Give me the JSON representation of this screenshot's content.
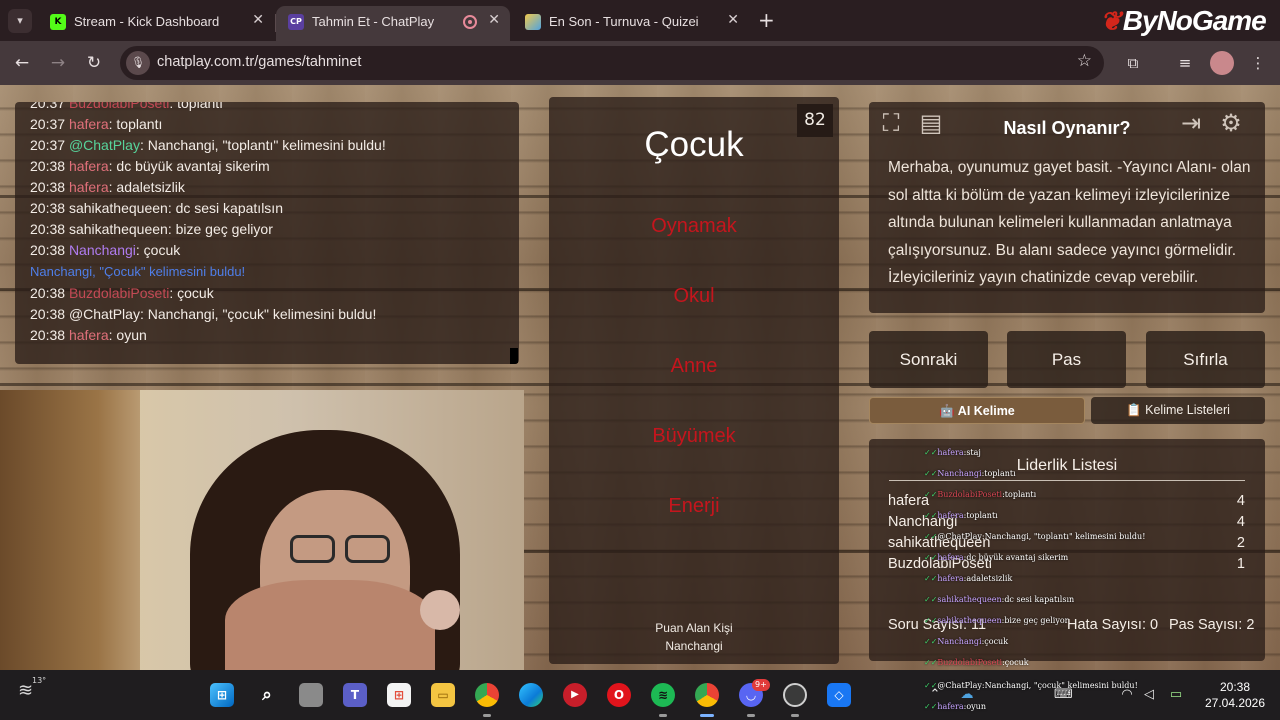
{
  "browser": {
    "tabs": [
      {
        "title": "Stream - Kick Dashboard",
        "favicon": "K",
        "active": false
      },
      {
        "title": "Tahmin Et - ChatPlay",
        "favicon": "CP",
        "active": true
      },
      {
        "title": "En Son - Turnuva - Quizei",
        "favicon": "Q",
        "active": false
      }
    ],
    "url": "chatplay.com.tr/games/tahminet",
    "brand": "ByNoGame"
  },
  "chat": {
    "lines": [
      {
        "time": "20:37",
        "user": "BuzdolabiPoseti",
        "text": ": toplantı"
      },
      {
        "time": "20:37",
        "user": "hafera",
        "text": ": toplantı"
      },
      {
        "time": "20:37",
        "user": "@ChatPlay",
        "text": ": Nanchangi, \"toplantı\" kelimesini buldu!"
      },
      {
        "time": "20:38",
        "user": "hafera",
        "text": ": dc büyük avantaj sikerim"
      },
      {
        "time": "20:38",
        "user": "hafera",
        "text": ": adaletsizlik"
      },
      {
        "time": "20:38",
        "user": "sahikathequeen",
        "text": ": dc sesi kapatılsın"
      },
      {
        "time": "20:38",
        "user": "sahikathequeen",
        "text": ": bize geç geliyor"
      },
      {
        "time": "20:38",
        "user": "Nanchangi",
        "text": ": çocuk"
      },
      {
        "time": "",
        "user": "Nanchangi, \"Çocuk\" kelimesini buldu!",
        "text": ""
      },
      {
        "time": "20:38",
        "user": "BuzdolabiPoseti",
        "text": ": çocuk"
      },
      {
        "time": "20:38",
        "user": "@ChatPlay",
        "text": ": Nanchangi, \"çocuk\" kelimesini buldu!"
      },
      {
        "time": "20:38",
        "user": "hafera",
        "text": ": oyun"
      }
    ]
  },
  "game": {
    "timer": "82",
    "word": "Çocuk",
    "taboo_words": [
      "Oynamak",
      "Okul",
      "Anne",
      "Büyümek",
      "Enerji"
    ],
    "scorer_label": "Puan Alan Kişi",
    "scorer_name": "Nanchangi"
  },
  "help": {
    "title": "Nasıl Oynanır?",
    "body": "Merhaba, oyunumuz gayet basit. -Yayıncı Alanı- olan sol altta ki bölüm de yazan kelimeyi izleyicilerinize altında bulunan kelimeleri kullanmadan anlatmaya çalışıyorsunuz. Bu alanı sadece yayıncı görmelidir. İzleyicileriniz yayın chatinizde cevap verebilir."
  },
  "controls": {
    "next": "Sonraki",
    "pass": "Pas",
    "reset": "Sıfırla",
    "ai_word": "🤖 AI Kelime",
    "word_lists": "📋 Kelime Listeleri"
  },
  "leaderboard": {
    "title": "Liderlik Listesi",
    "rows": [
      {
        "name": "hafera",
        "score": "4"
      },
      {
        "name": "Nanchangi",
        "score": "4"
      },
      {
        "name": "sahikathequeen",
        "score": "2"
      },
      {
        "name": "BuzdolabiPoseti",
        "score": "1"
      }
    ],
    "question_count": "Soru Sayısı: 11",
    "error_count": "Hata Sayısı: 0",
    "pass_count": "Pas Sayısı: 2"
  },
  "overlay_chat": [
    {
      "user": "hafera",
      "text": "staj"
    },
    {
      "user": "Nanchangi",
      "text": "toplantı"
    },
    {
      "user": "BuzdolabiPoseti",
      "text": "toplantı"
    },
    {
      "user": "hafera",
      "text": "toplantı"
    },
    {
      "user": "@ChatPlay",
      "text": "Nanchangi, \"toplantı\" kelimesini buldu!"
    },
    {
      "user": "hafera",
      "text": "dc büyük avantaj sikerim"
    },
    {
      "user": "hafera",
      "text": "adaletsizlik"
    },
    {
      "user": "sahikathequeen",
      "text": "dc sesi kapatılsın"
    },
    {
      "user": "sahikathequeen",
      "text": "bize geç geliyor"
    },
    {
      "user": "Nanchangi",
      "text": "çocuk"
    },
    {
      "user": "BuzdolabiPoseti",
      "text": "çocuk"
    },
    {
      "user": "@ChatPlay",
      "text": "Nanchangi, \"çocuk\" kelimesini buldu!"
    },
    {
      "user": "hafera",
      "text": "oyun"
    }
  ],
  "taskbar": {
    "weather_temp": "13°",
    "time": "20:38",
    "date": "27.04.2026",
    "badge": "9+"
  }
}
